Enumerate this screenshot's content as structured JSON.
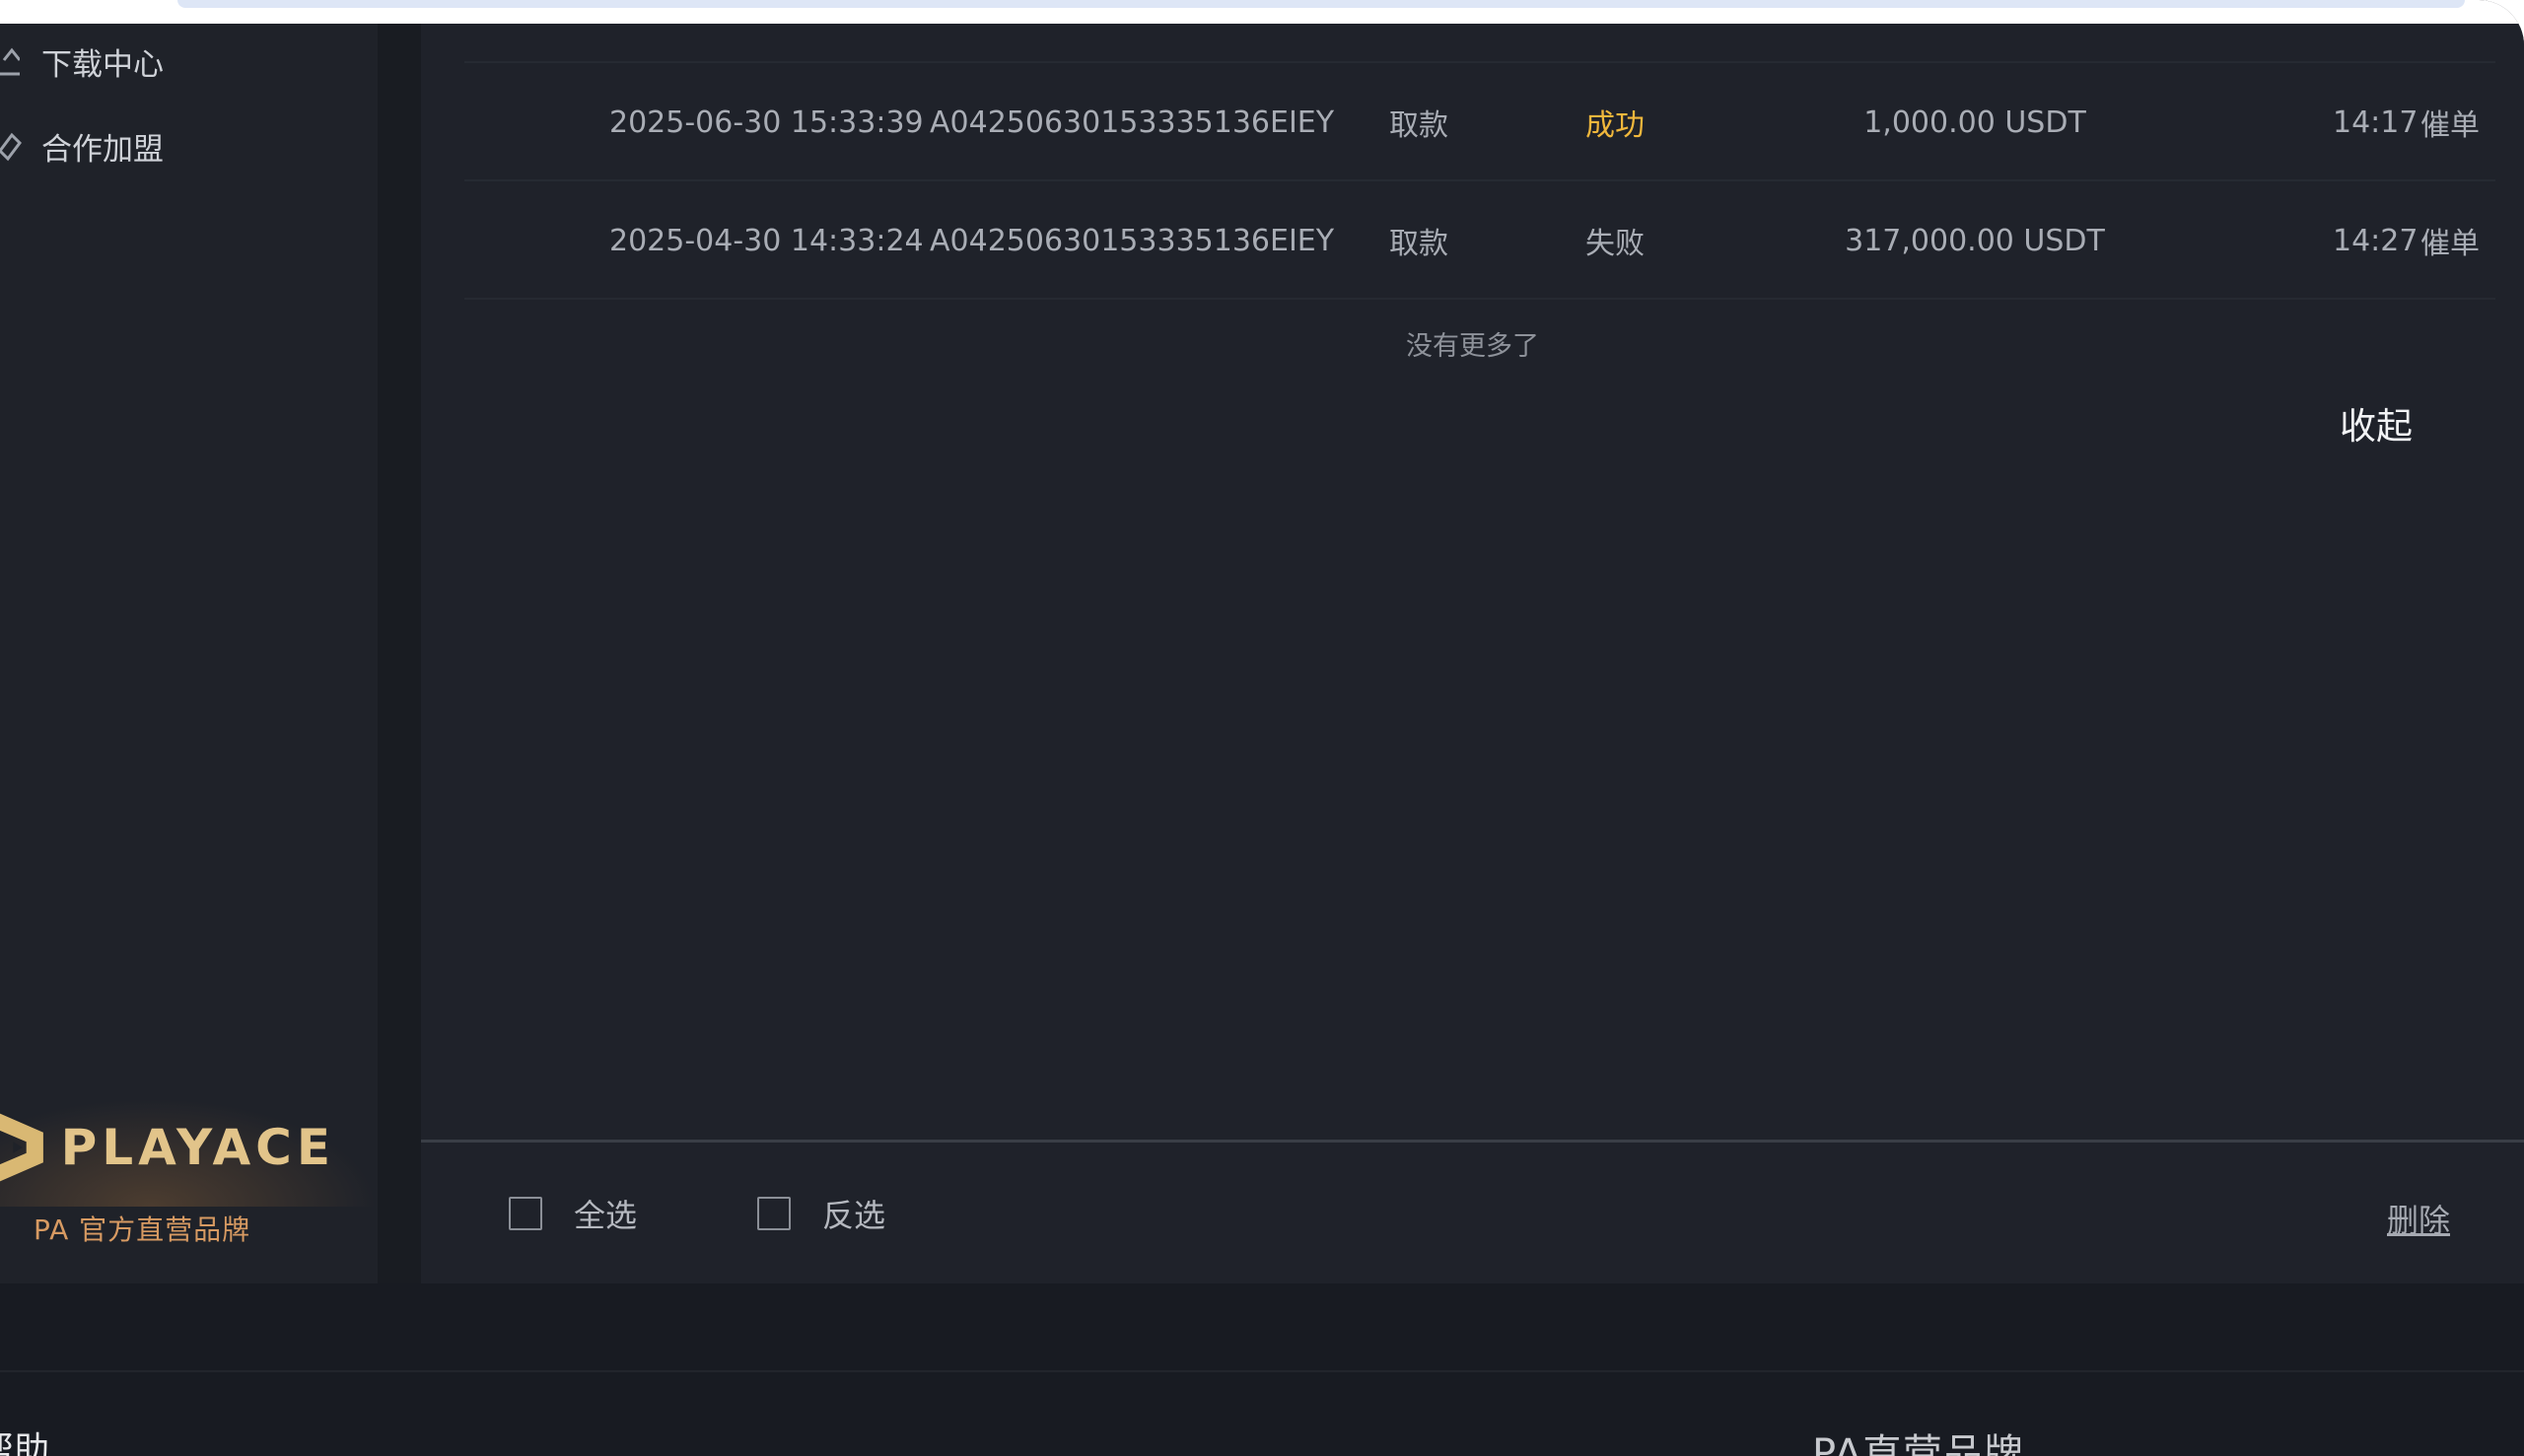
{
  "sidebar": {
    "items": [
      {
        "label": "下载中心",
        "icon": "download-icon"
      },
      {
        "label": "合作加盟",
        "icon": "handshake-icon"
      }
    ],
    "brand": {
      "logo_text": "PLAYACE",
      "subtitle": "PA 官方直营品牌",
      "accent": "#e2c48a"
    }
  },
  "records": {
    "columns": [
      "date",
      "order_id",
      "type",
      "status",
      "amount",
      "time",
      "action"
    ],
    "rows": [
      {
        "date": "2025-06-30 15:33:39",
        "order_id": "A04250630153335136EIEY",
        "type": "取款",
        "status": "成功",
        "status_kind": "success",
        "amount": "1,000.00 USDT",
        "time": "14:17",
        "action": "催单"
      },
      {
        "date": "2025-04-30 14:33:24",
        "order_id": "A04250630153335136EIEY",
        "type": "取款",
        "status": "失败",
        "status_kind": "failed",
        "amount": "317,000.00 USDT",
        "time": "14:27",
        "action": "催单"
      }
    ],
    "no_more_text": "没有更多了",
    "collapse_label": "收起"
  },
  "bulk_actions": {
    "select_all_label": "全选",
    "invert_label": "反选",
    "delete_label": "删除"
  },
  "page_footer": {
    "help_text": "帮助",
    "brand_text": "PA直营品牌"
  },
  "colors": {
    "background": "#181b22",
    "panel": "#1f222a",
    "success": "#f0b73c",
    "brand_orange": "#d79a62"
  }
}
